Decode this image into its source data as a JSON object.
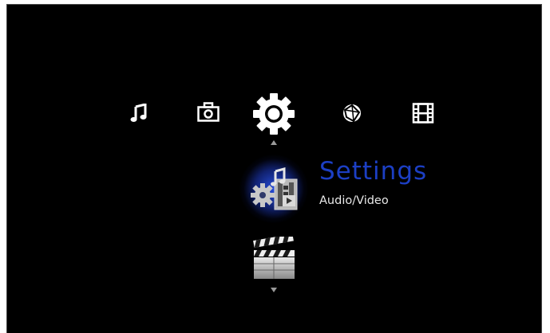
{
  "categories": [
    {
      "id": "music",
      "icon": "music-note-icon"
    },
    {
      "id": "photo",
      "icon": "camera-icon"
    },
    {
      "id": "settings",
      "icon": "gear-icon",
      "selected": true
    },
    {
      "id": "internet",
      "icon": "globe-icon"
    },
    {
      "id": "video",
      "icon": "film-strip-icon"
    }
  ],
  "selected_item": {
    "title": "Settings",
    "subtitle": "Audio/Video",
    "icon": "settings-audio-video-icon",
    "title_color": "#1c3fc4"
  },
  "next_item": {
    "icon": "clapperboard-icon"
  },
  "navigation": {
    "up_icon": "arrow-up-icon",
    "down_icon": "arrow-down-icon"
  }
}
